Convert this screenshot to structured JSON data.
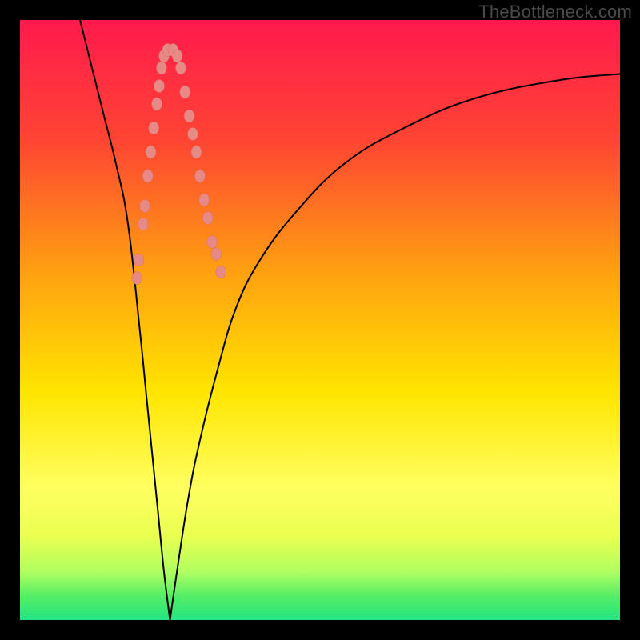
{
  "watermark": "TheBottleneck.com",
  "colors": {
    "gradient_stops": [
      {
        "pos": 0,
        "color": "#ff1a4d"
      },
      {
        "pos": 20,
        "color": "#ff4433"
      },
      {
        "pos": 42,
        "color": "#ffa010"
      },
      {
        "pos": 62,
        "color": "#ffe500"
      },
      {
        "pos": 78,
        "color": "#ffff60"
      },
      {
        "pos": 86,
        "color": "#eaff50"
      },
      {
        "pos": 92,
        "color": "#b0ff60"
      },
      {
        "pos": 96,
        "color": "#55ee66"
      },
      {
        "pos": 100,
        "color": "#23e482"
      }
    ],
    "curve": "#000000",
    "dot_fill": "#e78a85",
    "dot_stroke": "#da6a65",
    "frame": "#000000"
  },
  "chart_data": {
    "type": "line",
    "title": "",
    "xlabel": "",
    "ylabel": "",
    "xlim": [
      0,
      100
    ],
    "ylim": [
      0,
      100
    ],
    "description": "Bottleneck-style V curve. Two curves descend from top edge and meet at a flat bottom near x≈25; left curve from top-left corner, right curve rising toward upper right. Salmon dot markers cluster on both branches between roughly y=60 and y=95 (lower 40% of plot).",
    "series": [
      {
        "name": "left-branch",
        "x": [
          10,
          12,
          14,
          16,
          18,
          20,
          21,
          22,
          23,
          24,
          25
        ],
        "y": [
          100,
          92,
          84,
          76,
          66,
          48,
          38,
          28,
          18,
          8,
          0
        ]
      },
      {
        "name": "right-branch",
        "x": [
          25,
          26,
          28,
          30,
          33,
          36,
          40,
          46,
          54,
          64,
          76,
          90,
          100
        ],
        "y": [
          0,
          7,
          20,
          30,
          42,
          52,
          60,
          68,
          76,
          82,
          87,
          90,
          91
        ]
      }
    ],
    "markers": [
      {
        "branch": "left",
        "x": 19.5,
        "y": 57
      },
      {
        "branch": "left",
        "x": 19.8,
        "y": 60
      },
      {
        "branch": "left",
        "x": 20.5,
        "y": 66
      },
      {
        "branch": "left",
        "x": 20.8,
        "y": 69
      },
      {
        "branch": "left",
        "x": 21.3,
        "y": 74
      },
      {
        "branch": "left",
        "x": 21.8,
        "y": 78
      },
      {
        "branch": "left",
        "x": 22.3,
        "y": 82
      },
      {
        "branch": "left",
        "x": 22.8,
        "y": 86
      },
      {
        "branch": "left",
        "x": 23.2,
        "y": 89
      },
      {
        "branch": "left",
        "x": 23.6,
        "y": 92
      },
      {
        "branch": "left",
        "x": 24.0,
        "y": 94
      },
      {
        "branch": "left",
        "x": 24.6,
        "y": 95
      },
      {
        "branch": "right",
        "x": 25.5,
        "y": 95
      },
      {
        "branch": "right",
        "x": 26.2,
        "y": 94
      },
      {
        "branch": "right",
        "x": 26.8,
        "y": 92
      },
      {
        "branch": "right",
        "x": 27.5,
        "y": 88
      },
      {
        "branch": "right",
        "x": 28.2,
        "y": 84
      },
      {
        "branch": "right",
        "x": 28.8,
        "y": 81
      },
      {
        "branch": "right",
        "x": 29.4,
        "y": 78
      },
      {
        "branch": "right",
        "x": 30.0,
        "y": 74
      },
      {
        "branch": "right",
        "x": 30.7,
        "y": 70
      },
      {
        "branch": "right",
        "x": 31.3,
        "y": 67
      },
      {
        "branch": "right",
        "x": 32.0,
        "y": 63
      },
      {
        "branch": "right",
        "x": 32.7,
        "y": 61
      },
      {
        "branch": "right",
        "x": 33.5,
        "y": 58
      }
    ]
  }
}
